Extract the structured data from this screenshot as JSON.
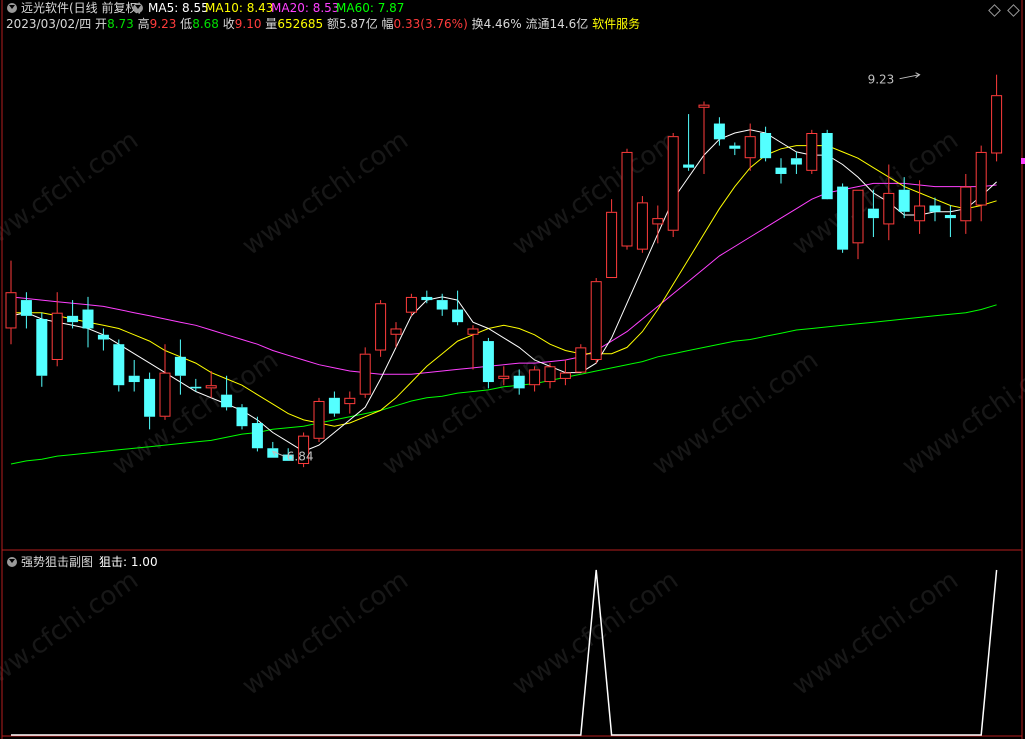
{
  "header": {
    "title": "远光软件(日线 前复权)",
    "ma_labels": [
      {
        "text": "MA5: 8.55",
        "color": "#ffffff"
      },
      {
        "text": "MA10: 8.43",
        "color": "#ffff00"
      },
      {
        "text": "MA20: 8.53",
        "color": "#ff40ff"
      },
      {
        "text": "MA60: 7.87",
        "color": "#00ff00"
      }
    ],
    "info": {
      "date": "2023/03/02/四",
      "open_label": "开",
      "open": "8.73",
      "high_label": "高",
      "high": "9.23",
      "low_label": "低",
      "low": "8.68",
      "close_label": "收",
      "close": "9.10",
      "vol_label": "量",
      "vol": "652685",
      "amt_label": "额",
      "amt": "5.87亿",
      "chg_label": "幅",
      "chg": "0.33(3.76%)",
      "turnover": "换4.46%",
      "float": "流通14.6亿",
      "industry": "软件服务"
    }
  },
  "sub_header": {
    "title": "强势狙击副图",
    "indicator": "狙击: 1.00"
  },
  "watermark": "www.cfchi.com",
  "colors": {
    "up": "#ff3c3c",
    "down": "#54ffff",
    "ma5": "#ffffff",
    "ma10": "#ffff00",
    "ma20": "#ff40ff",
    "ma60": "#00ff00",
    "frame": "#b41e1e",
    "sub_line": "#ffffff"
  },
  "chart_data": [
    {
      "type": "candlestick",
      "ylim": [
        6.5,
        9.45
      ],
      "annotations": [
        {
          "text": "9.23",
          "value": 9.23,
          "index": 59
        },
        {
          "text": "6.84",
          "value": 6.84,
          "index": 17
        }
      ],
      "candles": [
        {
          "o": 7.62,
          "h": 8.05,
          "l": 7.52,
          "c": 7.85
        },
        {
          "o": 7.8,
          "h": 7.85,
          "l": 7.62,
          "c": 7.7
        },
        {
          "o": 7.68,
          "h": 7.72,
          "l": 7.25,
          "c": 7.32
        },
        {
          "o": 7.42,
          "h": 7.85,
          "l": 7.38,
          "c": 7.72
        },
        {
          "o": 7.7,
          "h": 7.8,
          "l": 7.62,
          "c": 7.66
        },
        {
          "o": 7.74,
          "h": 7.82,
          "l": 7.5,
          "c": 7.62
        },
        {
          "o": 7.58,
          "h": 7.62,
          "l": 7.48,
          "c": 7.55
        },
        {
          "o": 7.52,
          "h": 7.55,
          "l": 7.22,
          "c": 7.26
        },
        {
          "o": 7.32,
          "h": 7.42,
          "l": 7.22,
          "c": 7.28
        },
        {
          "o": 7.3,
          "h": 7.34,
          "l": 6.98,
          "c": 7.06
        },
        {
          "o": 7.06,
          "h": 7.52,
          "l": 7.04,
          "c": 7.34
        },
        {
          "o": 7.44,
          "h": 7.55,
          "l": 7.2,
          "c": 7.32
        },
        {
          "o": 7.25,
          "h": 7.3,
          "l": 7.22,
          "c": 7.24
        },
        {
          "o": 7.24,
          "h": 7.35,
          "l": 7.18,
          "c": 7.26
        },
        {
          "o": 7.2,
          "h": 7.32,
          "l": 7.1,
          "c": 7.12
        },
        {
          "o": 7.12,
          "h": 7.14,
          "l": 6.98,
          "c": 7.0
        },
        {
          "o": 7.02,
          "h": 7.06,
          "l": 6.84,
          "c": 6.86
        },
        {
          "o": 6.86,
          "h": 6.9,
          "l": 6.8,
          "c": 6.8
        },
        {
          "o": 6.82,
          "h": 6.86,
          "l": 6.78,
          "c": 6.78
        },
        {
          "o": 6.76,
          "h": 6.96,
          "l": 6.74,
          "c": 6.94
        },
        {
          "o": 6.92,
          "h": 7.18,
          "l": 6.9,
          "c": 7.16
        },
        {
          "o": 7.18,
          "h": 7.22,
          "l": 7.06,
          "c": 7.08
        },
        {
          "o": 7.14,
          "h": 7.22,
          "l": 7.08,
          "c": 7.18
        },
        {
          "o": 7.2,
          "h": 7.5,
          "l": 7.18,
          "c": 7.46
        },
        {
          "o": 7.48,
          "h": 7.8,
          "l": 7.44,
          "c": 7.78
        },
        {
          "o": 7.58,
          "h": 7.66,
          "l": 7.5,
          "c": 7.62
        },
        {
          "o": 7.72,
          "h": 7.84,
          "l": 7.7,
          "c": 7.82
        },
        {
          "o": 7.82,
          "h": 7.86,
          "l": 7.78,
          "c": 7.8
        },
        {
          "o": 7.8,
          "h": 7.84,
          "l": 7.7,
          "c": 7.74
        },
        {
          "o": 7.74,
          "h": 7.86,
          "l": 7.64,
          "c": 7.66
        },
        {
          "o": 7.58,
          "h": 7.64,
          "l": 7.36,
          "c": 7.62
        },
        {
          "o": 7.54,
          "h": 7.56,
          "l": 7.24,
          "c": 7.28
        },
        {
          "o": 7.3,
          "h": 7.38,
          "l": 7.26,
          "c": 7.32
        },
        {
          "o": 7.32,
          "h": 7.36,
          "l": 7.2,
          "c": 7.24
        },
        {
          "o": 7.26,
          "h": 7.38,
          "l": 7.22,
          "c": 7.36
        },
        {
          "o": 7.28,
          "h": 7.4,
          "l": 7.24,
          "c": 7.38
        },
        {
          "o": 7.3,
          "h": 7.42,
          "l": 7.26,
          "c": 7.34
        },
        {
          "o": 7.34,
          "h": 7.52,
          "l": 7.34,
          "c": 7.5
        },
        {
          "o": 7.42,
          "h": 7.94,
          "l": 7.4,
          "c": 7.92
        },
        {
          "o": 7.94,
          "h": 8.44,
          "l": 7.94,
          "c": 8.36
        },
        {
          "o": 8.14,
          "h": 8.76,
          "l": 8.12,
          "c": 8.74
        },
        {
          "o": 8.12,
          "h": 8.46,
          "l": 8.1,
          "c": 8.42
        },
        {
          "o": 8.28,
          "h": 8.4,
          "l": 8.16,
          "c": 8.32
        },
        {
          "o": 8.24,
          "h": 8.86,
          "l": 8.2,
          "c": 8.84
        },
        {
          "o": 8.66,
          "h": 8.98,
          "l": 8.62,
          "c": 8.64
        },
        {
          "o": 9.02,
          "h": 9.06,
          "l": 8.6,
          "c": 9.04
        },
        {
          "o": 8.92,
          "h": 8.96,
          "l": 8.78,
          "c": 8.82
        },
        {
          "o": 8.78,
          "h": 8.8,
          "l": 8.72,
          "c": 8.76
        },
        {
          "o": 8.7,
          "h": 8.92,
          "l": 8.62,
          "c": 8.84
        },
        {
          "o": 8.86,
          "h": 8.9,
          "l": 8.68,
          "c": 8.7
        },
        {
          "o": 8.64,
          "h": 8.7,
          "l": 8.54,
          "c": 8.6
        },
        {
          "o": 8.7,
          "h": 8.74,
          "l": 8.6,
          "c": 8.66
        },
        {
          "o": 8.62,
          "h": 8.88,
          "l": 8.6,
          "c": 8.86
        },
        {
          "o": 8.86,
          "h": 8.88,
          "l": 8.46,
          "c": 8.44
        },
        {
          "o": 8.52,
          "h": 8.54,
          "l": 8.1,
          "c": 8.12
        },
        {
          "o": 8.16,
          "h": 8.5,
          "l": 8.06,
          "c": 8.5
        },
        {
          "o": 8.38,
          "h": 8.5,
          "l": 8.2,
          "c": 8.32
        },
        {
          "o": 8.28,
          "h": 8.66,
          "l": 8.18,
          "c": 8.48
        },
        {
          "o": 8.5,
          "h": 8.58,
          "l": 8.32,
          "c": 8.36
        },
        {
          "o": 8.3,
          "h": 8.56,
          "l": 8.22,
          "c": 8.4
        },
        {
          "o": 8.4,
          "h": 8.45,
          "l": 8.3,
          "c": 8.36
        },
        {
          "o": 8.34,
          "h": 8.4,
          "l": 8.2,
          "c": 8.32
        },
        {
          "o": 8.3,
          "h": 8.6,
          "l": 8.22,
          "c": 8.52
        },
        {
          "o": 8.4,
          "h": 8.78,
          "l": 8.3,
          "c": 8.74
        },
        {
          "o": 8.73,
          "h": 9.23,
          "l": 8.68,
          "c": 9.1
        }
      ],
      "ma5": [
        7.7,
        7.72,
        7.68,
        7.66,
        7.64,
        7.62,
        7.58,
        7.52,
        7.46,
        7.4,
        7.34,
        7.28,
        7.22,
        7.18,
        7.14,
        7.1,
        7.04,
        6.96,
        6.9,
        6.84,
        6.88,
        6.96,
        7.04,
        7.12,
        7.3,
        7.5,
        7.7,
        7.8,
        7.82,
        7.8,
        7.66,
        7.62,
        7.56,
        7.5,
        7.42,
        7.38,
        7.34,
        7.34,
        7.4,
        7.56,
        7.78,
        8.0,
        8.22,
        8.44,
        8.58,
        8.72,
        8.82,
        8.86,
        8.88,
        8.86,
        8.8,
        8.74,
        8.72,
        8.72,
        8.66,
        8.58,
        8.48,
        8.42,
        8.34,
        8.34,
        8.36,
        8.36,
        8.38,
        8.46,
        8.55
      ],
      "ma10": [
        7.72,
        7.72,
        7.72,
        7.7,
        7.68,
        7.66,
        7.64,
        7.62,
        7.58,
        7.54,
        7.48,
        7.44,
        7.4,
        7.34,
        7.3,
        7.26,
        7.2,
        7.14,
        7.08,
        7.04,
        7.02,
        7.0,
        7.02,
        7.06,
        7.1,
        7.18,
        7.28,
        7.38,
        7.46,
        7.54,
        7.58,
        7.62,
        7.64,
        7.62,
        7.58,
        7.52,
        7.48,
        7.46,
        7.46,
        7.46,
        7.5,
        7.6,
        7.74,
        7.9,
        8.06,
        8.22,
        8.38,
        8.52,
        8.64,
        8.72,
        8.76,
        8.78,
        8.78,
        8.78,
        8.74,
        8.7,
        8.64,
        8.58,
        8.52,
        8.48,
        8.44,
        8.4,
        8.38,
        8.4,
        8.43
      ],
      "ma20": [
        7.82,
        7.81,
        7.8,
        7.79,
        7.78,
        7.77,
        7.76,
        7.74,
        7.72,
        7.7,
        7.68,
        7.66,
        7.64,
        7.61,
        7.58,
        7.55,
        7.52,
        7.48,
        7.45,
        7.42,
        7.39,
        7.37,
        7.35,
        7.34,
        7.33,
        7.33,
        7.33,
        7.34,
        7.35,
        7.36,
        7.37,
        7.38,
        7.39,
        7.4,
        7.4,
        7.41,
        7.42,
        7.44,
        7.48,
        7.54,
        7.6,
        7.68,
        7.76,
        7.84,
        7.92,
        8.0,
        8.08,
        8.14,
        8.2,
        8.26,
        8.32,
        8.38,
        8.44,
        8.48,
        8.5,
        8.52,
        8.54,
        8.54,
        8.54,
        8.53,
        8.52,
        8.52,
        8.52,
        8.52,
        8.53
      ],
      "ma60": [
        6.76,
        6.78,
        6.79,
        6.81,
        6.82,
        6.83,
        6.84,
        6.85,
        6.86,
        6.87,
        6.88,
        6.89,
        6.9,
        6.91,
        6.93,
        6.95,
        6.96,
        6.98,
        6.99,
        7.0,
        7.02,
        7.04,
        7.06,
        7.08,
        7.1,
        7.13,
        7.16,
        7.18,
        7.19,
        7.21,
        7.22,
        7.23,
        7.25,
        7.26,
        7.27,
        7.29,
        7.31,
        7.33,
        7.35,
        7.37,
        7.39,
        7.41,
        7.44,
        7.46,
        7.48,
        7.5,
        7.52,
        7.54,
        7.55,
        7.57,
        7.59,
        7.61,
        7.62,
        7.63,
        7.64,
        7.65,
        7.66,
        7.67,
        7.68,
        7.69,
        7.7,
        7.71,
        7.72,
        7.74,
        7.77
      ]
    },
    {
      "type": "line",
      "name": "狙击",
      "ylim": [
        0,
        1
      ],
      "values": [
        0,
        0,
        0,
        0,
        0,
        0,
        0,
        0,
        0,
        0,
        0,
        0,
        0,
        0,
        0,
        0,
        0,
        0,
        0,
        0,
        0,
        0,
        0,
        0,
        0,
        0,
        0,
        0,
        0,
        0,
        0,
        0,
        0,
        0,
        0,
        0,
        0,
        0,
        1,
        0,
        0,
        0,
        0,
        0,
        0,
        0,
        0,
        0,
        0,
        0,
        0,
        0,
        0,
        0,
        0,
        0,
        0,
        0,
        0,
        0,
        0,
        0,
        0,
        0,
        1
      ]
    }
  ]
}
